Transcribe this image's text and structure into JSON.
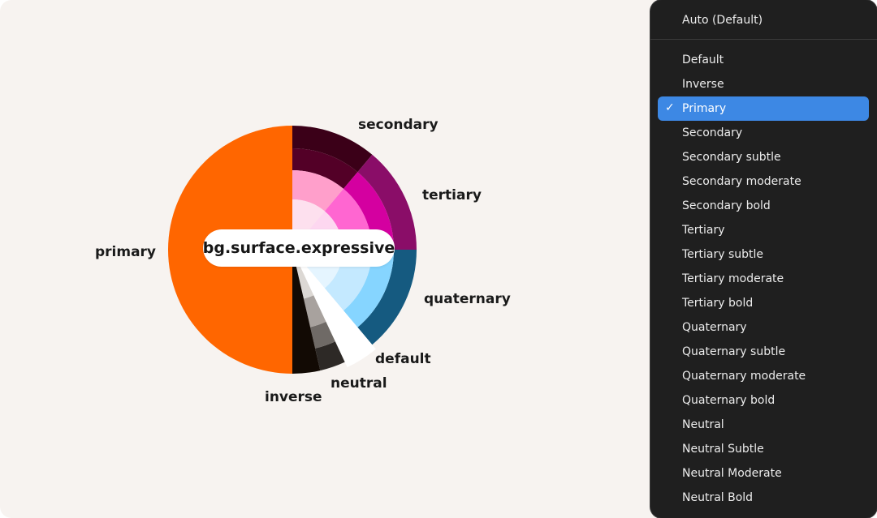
{
  "diagram": {
    "center_label": "bg.surface.expressive",
    "segments": [
      {
        "key": "primary",
        "label": "primary",
        "color": "#ff6600"
      },
      {
        "key": "secondary",
        "label": "secondary",
        "colors": [
          "#3b0018",
          "#530027",
          "#ff9fcb",
          "#fde0ee"
        ]
      },
      {
        "key": "tertiary",
        "label": "tertiary",
        "colors": [
          "#8a0d68",
          "#d400a0",
          "#ff66d1",
          "#fdd7f0"
        ]
      },
      {
        "key": "quaternary",
        "label": "quaternary",
        "colors": [
          "#155a80",
          "#86d5ff",
          "#c4e9ff",
          "#e5f5ff"
        ]
      },
      {
        "key": "default",
        "label": "default",
        "color": "#ffffff"
      },
      {
        "key": "neutral",
        "label": "neutral",
        "colors": [
          "#2d2926",
          "#6f6a66",
          "#a8a29e",
          "#dcd8d4"
        ]
      },
      {
        "key": "inverse",
        "label": "inverse",
        "color": "#120a04"
      }
    ]
  },
  "menu": {
    "items": [
      {
        "label": "Auto (Default)",
        "selected": false
      },
      {
        "label": "Default",
        "selected": false
      },
      {
        "label": "Inverse",
        "selected": false
      },
      {
        "label": "Primary",
        "selected": true
      },
      {
        "label": "Secondary",
        "selected": false
      },
      {
        "label": "Secondary subtle",
        "selected": false
      },
      {
        "label": "Secondary moderate",
        "selected": false
      },
      {
        "label": "Secondary bold",
        "selected": false
      },
      {
        "label": "Tertiary",
        "selected": false
      },
      {
        "label": "Tertiary subtle",
        "selected": false
      },
      {
        "label": "Tertiary moderate",
        "selected": false
      },
      {
        "label": "Tertiary bold",
        "selected": false
      },
      {
        "label": "Quaternary",
        "selected": false
      },
      {
        "label": "Quaternary subtle",
        "selected": false
      },
      {
        "label": "Quaternary moderate",
        "selected": false
      },
      {
        "label": "Quaternary bold",
        "selected": false
      },
      {
        "label": "Neutral",
        "selected": false
      },
      {
        "label": "Neutral Subtle",
        "selected": false
      },
      {
        "label": "Neutral Moderate",
        "selected": false
      },
      {
        "label": "Neutral Bold",
        "selected": false
      }
    ],
    "check_glyph": "✓",
    "selected_color": "#3d88e4"
  }
}
